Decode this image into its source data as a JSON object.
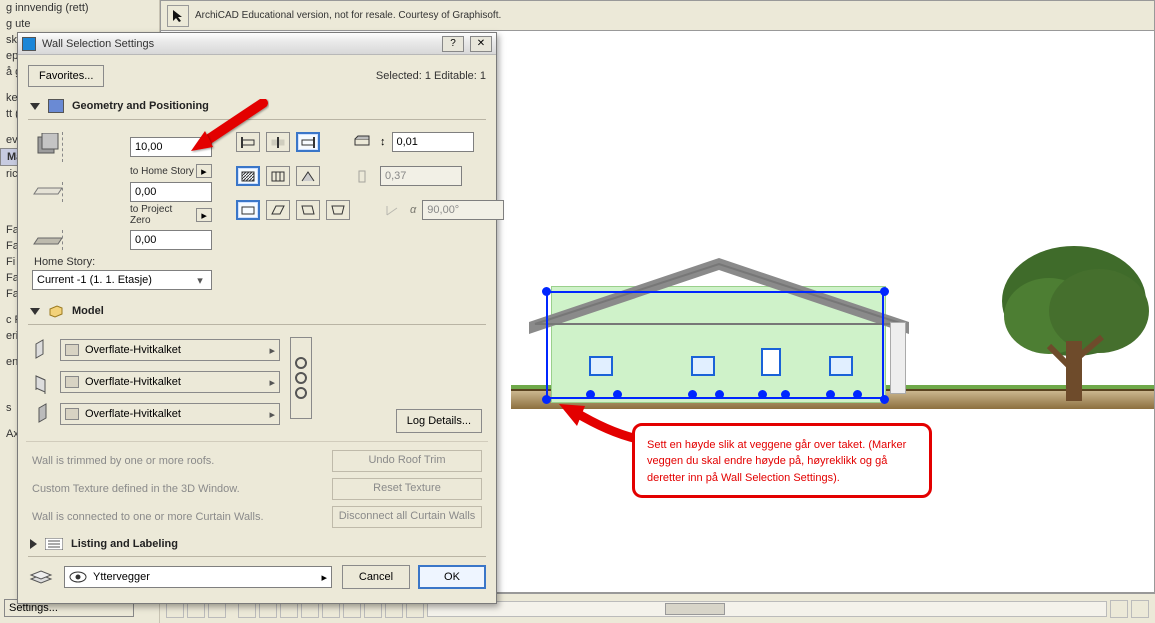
{
  "background": {
    "left_panel_items": [
      "g innvendig (rett)",
      "g ute",
      "skille",
      "epo",
      "å gr",
      "ket",
      "tt (",
      "evie",
      "  Ma",
      "ric",
      "Fas",
      "Fase",
      "Fi",
      "Fas",
      "Fa",
      "c Pi",
      "eric",
      "ents",
      "s",
      "Axc"
    ],
    "settings_button": "Settings...",
    "watermark": "ArchiCAD Educational version, not for resale. Courtesy of Graphisoft."
  },
  "dialog": {
    "title": "Wall Selection Settings",
    "favorites": "Favorites...",
    "selected_text": "Selected: 1 Editable: 1",
    "panel_geo_title": "Geometry and Positioning",
    "height_top": "10,00",
    "to_home_story": "to Home Story",
    "height_mid": "0,00",
    "to_project_zero": "to Project Zero",
    "height_bot": "0,00",
    "const_val": "0,01",
    "thickness": "0,37",
    "angle": "90,00°",
    "home_story_label": "Home Story:",
    "home_story_value": "Current -1 (1. 1. Etasje)",
    "panel_model_title": "Model",
    "surface1": "Overflate-Hvitkalket",
    "surface2": "Overflate-Hvitkalket",
    "surface3": "Overflate-Hvitkalket",
    "log_details": "Log Details...",
    "note1": "Wall is trimmed by one or more roofs.",
    "btn_note1": "Undo Roof Trim",
    "note2": "Custom Texture defined in the 3D Window.",
    "btn_note2": "Reset Texture",
    "note3": "Wall is connected to one or more Curtain Walls.",
    "btn_note3": "Disconnect all Curtain Walls",
    "panel_ll_title": "Listing and Labeling",
    "layer": "Yttervegger",
    "cancel": "Cancel",
    "ok": "OK"
  },
  "callout": {
    "text": "Sett en høyde slik at veggene går over taket. (Marker veggen du skal endre høyde på, høyreklikk og gå deretter inn på Wall Selection Settings)."
  }
}
